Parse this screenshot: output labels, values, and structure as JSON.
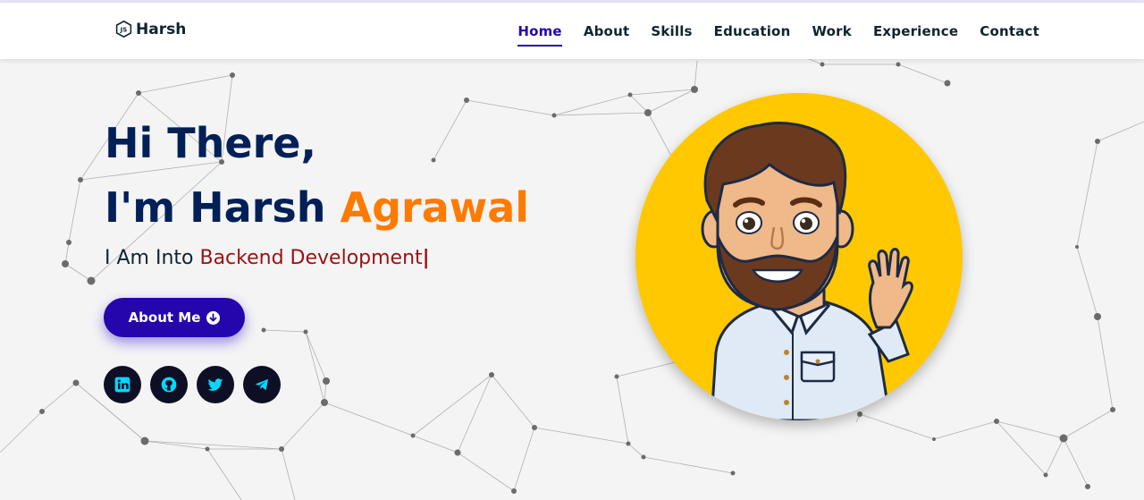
{
  "brand": {
    "name": "Harsh",
    "logo_icon": "js-hexagon-icon"
  },
  "nav": {
    "items": [
      {
        "label": "Home",
        "active": true
      },
      {
        "label": "About",
        "active": false
      },
      {
        "label": "Skills",
        "active": false
      },
      {
        "label": "Education",
        "active": false
      },
      {
        "label": "Work",
        "active": false
      },
      {
        "label": "Experience",
        "active": false
      },
      {
        "label": "Contact",
        "active": false
      }
    ]
  },
  "hero": {
    "greeting": "Hi There,",
    "intro_prefix": "I'm Harsh",
    "intro_accent": "Agrawal",
    "role_prefix": "I Am Into",
    "role_typed": "Backend Development",
    "caret": "|",
    "button_label": "About Me",
    "button_icon": "arrow-circle-down-icon"
  },
  "socials": [
    {
      "name": "linkedin",
      "icon": "linkedin-icon"
    },
    {
      "name": "github",
      "icon": "github-icon"
    },
    {
      "name": "twitter",
      "icon": "twitter-icon"
    },
    {
      "name": "telegram",
      "icon": "telegram-icon"
    }
  ],
  "colors": {
    "primary": "#2506ad",
    "heading": "#002057",
    "accent": "#ff7a00",
    "typed": "#991212",
    "avatar_bg": "#ffc800",
    "social_bg": "#0e0e25",
    "social_icon": "#00d9ff"
  }
}
